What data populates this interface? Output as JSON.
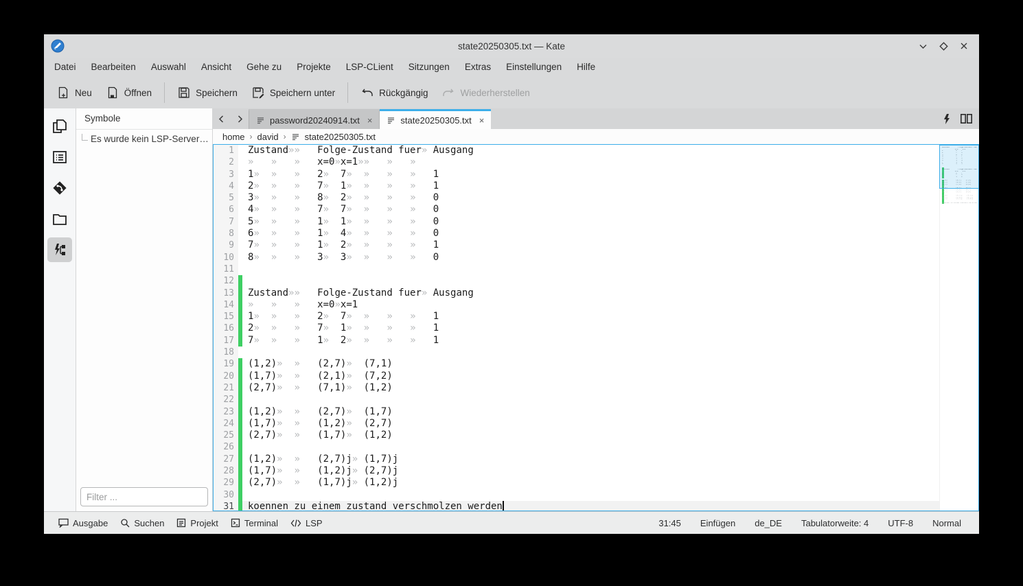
{
  "window": {
    "title": "state20250305.txt — Kate",
    "controls": {
      "minimize": "minimize",
      "maximize": "maximize",
      "close": "close"
    }
  },
  "colors": {
    "accent": "#3daee9",
    "modified_green": "#3ecf63",
    "chrome": "#d9dadb"
  },
  "menu": {
    "items": [
      "Datei",
      "Bearbeiten",
      "Auswahl",
      "Ansicht",
      "Gehe zu",
      "Projekte",
      "LSP-CLient",
      "Sitzungen",
      "Extras",
      "Einstellungen",
      "Hilfe"
    ]
  },
  "toolbar": {
    "new": "Neu",
    "open": "Öffnen",
    "save": "Speichern",
    "save_as": "Speichern unter",
    "undo": "Rückgängig",
    "redo": "Wiederherstellen"
  },
  "sidebar": {
    "panel_title": "Symbole",
    "tree_item": "Es wurde kein LSP-Server fü...",
    "filter_placeholder": "Filter ..."
  },
  "tabs": [
    {
      "label": "password20240914.txt",
      "active": false
    },
    {
      "label": "state20250305.txt",
      "active": true
    }
  ],
  "breadcrumb": {
    "segments": [
      "home",
      "david",
      "state20250305.txt"
    ]
  },
  "editor": {
    "tab_width": 4,
    "current_line": 31,
    "cursor_at_end_of_line": true,
    "modified_lines": [
      12,
      13,
      14,
      15,
      16,
      17,
      19,
      20,
      21,
      22,
      23,
      24,
      25,
      26,
      27,
      28,
      29,
      30,
      31
    ],
    "minimap_dim_from_line": 24,
    "lines": [
      "Zustand\t\tFolge-Zustand fuer\tAusgang",
      "\t\t\tx=0\tx=1\t\t\t\t",
      "1\t\t\t2\t7\t\t\t\t1",
      "2\t\t\t7\t1\t\t\t\t1",
      "3\t\t\t8\t2\t\t\t\t0",
      "4\t\t\t7\t7\t\t\t\t0",
      "5\t\t\t1\t1\t\t\t\t0",
      "6\t\t\t1\t4\t\t\t\t0",
      "7\t\t\t1\t2\t\t\t\t1",
      "8\t\t\t3\t3\t\t\t\t0",
      "",
      "",
      "Zustand\t\tFolge-Zustand fuer\tAusgang",
      "\t\t\tx=0\tx=1",
      "1\t\t\t2\t7\t\t\t\t1",
      "2\t\t\t7\t1\t\t\t\t1",
      "7\t\t\t1\t2\t\t\t\t1",
      "",
      "(1,2)\t\t(2,7)\t(7,1)",
      "(1,7)\t\t(2,1)\t(7,2)",
      "(2,7)\t\t(7,1)\t(1,2)",
      "",
      "(1,2)\t\t(2,7)\t(1,7)",
      "(1,7)\t\t(1,2)\t(2,7)",
      "(2,7)\t\t(1,7)\t(1,2)",
      "",
      "(1,2)\t\t(2,7)j\t(1,7)j",
      "(1,7)\t\t(1,2)j\t(2,7)j",
      "(2,7)\t\t(1,7)j\t(1,2)j",
      "",
      "koennen zu einem zustand verschmolzen werden",
      ""
    ]
  },
  "statusbar": {
    "toggles": [
      {
        "label": "Ausgabe"
      },
      {
        "label": "Suchen"
      },
      {
        "label": "Projekt"
      },
      {
        "label": "Terminal"
      },
      {
        "label": "LSP"
      }
    ],
    "cursor_position": "31:45",
    "input_mode": "Einfügen",
    "dictionary": "de_DE",
    "tab_width_label": "Tabulatorweite: 4",
    "encoding": "UTF-8",
    "edit_mode": "Normal"
  }
}
